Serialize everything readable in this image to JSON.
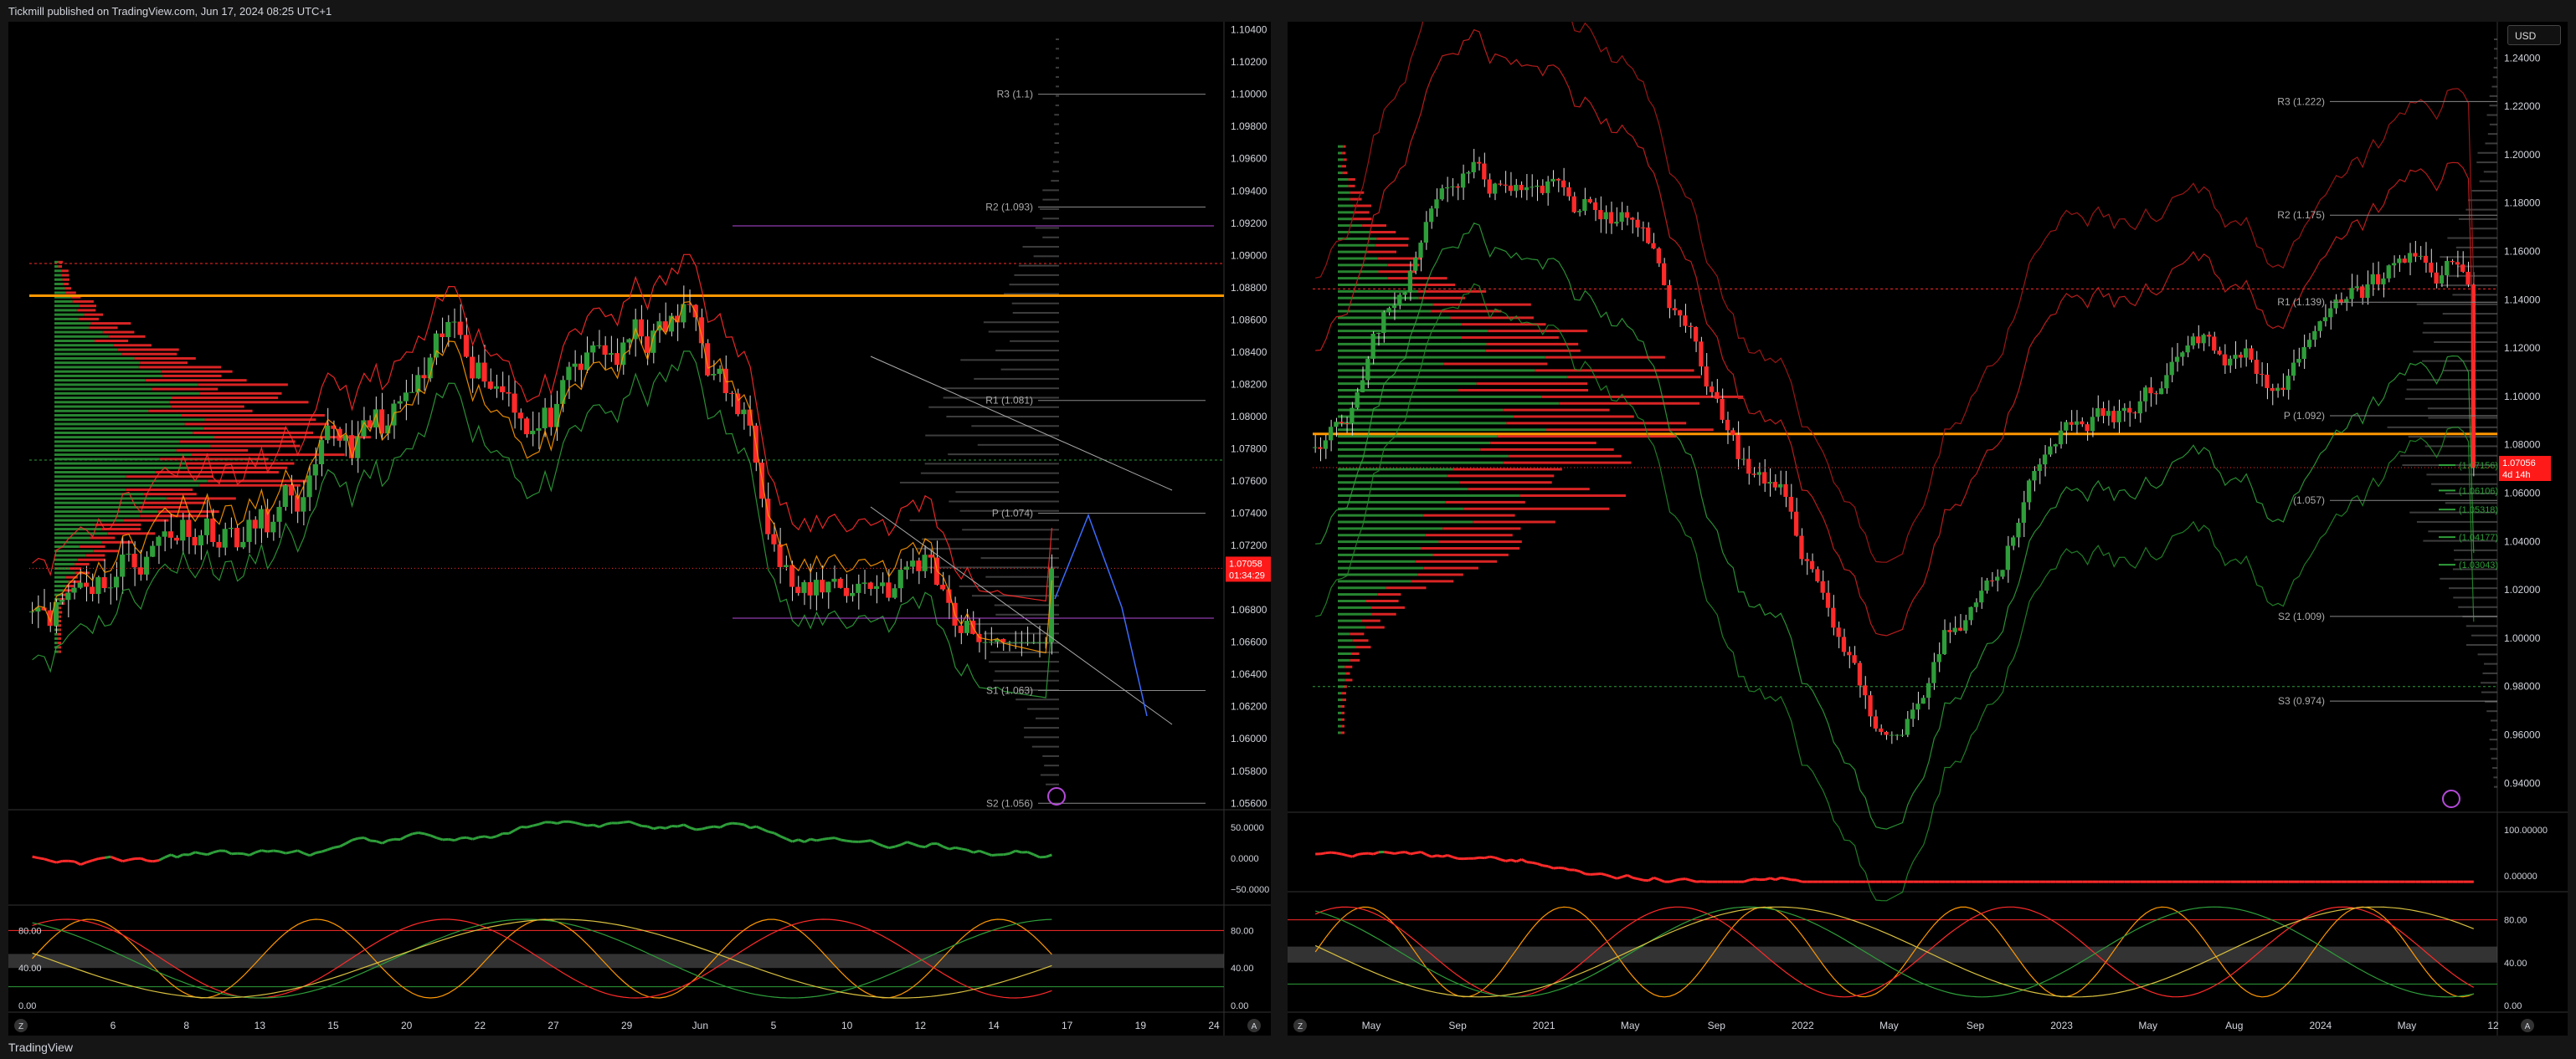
{
  "header": {
    "title": "Tickmill published on TradingView.com, Jun 17, 2024 08:25 UTC+1"
  },
  "footer": {
    "logo": "TradingView"
  },
  "colors": {
    "bull": "#2e9e3a",
    "bear": "#ff2a2a",
    "orange": "#ff9800",
    "purple": "#b44ad8",
    "grid": "#222222"
  },
  "left": {
    "price_ticks": [
      "1.10400",
      "1.10200",
      "1.10000",
      "1.09800",
      "1.09600",
      "1.09400",
      "1.09200",
      "1.09000",
      "1.08800",
      "1.08600",
      "1.08400",
      "1.08200",
      "1.08000",
      "1.07800",
      "1.07600",
      "1.07400",
      "1.07200",
      "1.07000",
      "1.06800",
      "1.06600",
      "1.06400",
      "1.06200",
      "1.06000",
      "1.05800",
      "1.05600"
    ],
    "price_range": [
      1.0556,
      1.1045
    ],
    "pivots": [
      {
        "label": "R3 (1.1)",
        "price": 1.1
      },
      {
        "label": "R2 (1.093)",
        "price": 1.093
      },
      {
        "label": "R1 (1.081)",
        "price": 1.081
      },
      {
        "label": "P (1.074)",
        "price": 1.074
      },
      {
        "label": "S1 (1.063)",
        "price": 1.063
      },
      {
        "label": "S2 (1.056)",
        "price": 1.056
      }
    ],
    "last_price": "1.07058",
    "countdown": "01:34:29",
    "osc1_ticks": [
      "50.0000",
      "0.0000",
      "−50.0000"
    ],
    "osc2_ticks_left": [
      "80.00",
      "40.00",
      "0.00"
    ],
    "osc2_ticks_right": [
      "80.00",
      "40.00",
      "0.00"
    ],
    "time_labels": [
      "6",
      "8",
      "13",
      "15",
      "20",
      "22",
      "27",
      "29",
      "Jun",
      "5",
      "10",
      "12",
      "14",
      "17",
      "19",
      "24"
    ],
    "z_button": "Z",
    "a_button": "A"
  },
  "right": {
    "currency": "USD",
    "price_ticks": [
      "1.24000",
      "1.22000",
      "1.20000",
      "1.18000",
      "1.16000",
      "1.14000",
      "1.12000",
      "1.10000",
      "1.08000",
      "1.06000",
      "1.04000",
      "1.02000",
      "1.00000",
      "0.98000",
      "0.96000",
      "0.94000"
    ],
    "price_range": [
      0.928,
      1.255
    ],
    "pivots": [
      {
        "label": "R3 (1.222)",
        "price": 1.222
      },
      {
        "label": "R2 (1.175)",
        "price": 1.175
      },
      {
        "label": "R1 (1.139)",
        "price": 1.139
      },
      {
        "label": "P (1.092)",
        "price": 1.092
      },
      {
        "label": "(1.057)",
        "price": 1.057
      },
      {
        "label": "S2 (1.009)",
        "price": 1.009
      },
      {
        "label": "S3 (0.974)",
        "price": 0.974
      }
    ],
    "band_labels": [
      {
        "label": "(1.07156)",
        "price": 1.0716
      },
      {
        "label": "(1.06106)",
        "price": 1.0611
      },
      {
        "label": "(1.05318)",
        "price": 1.0532
      },
      {
        "label": "(1.04177)",
        "price": 1.0418
      },
      {
        "label": "(1.03043)",
        "price": 1.0304
      }
    ],
    "last_price": "1.07056",
    "countdown": "4d 14h",
    "osc1_ticks": [
      "100.00000",
      "0.00000"
    ],
    "osc2_ticks": [
      "80.00",
      "40.00",
      "0.00"
    ],
    "time_labels": [
      "May",
      "Sep",
      "2021",
      "May",
      "Sep",
      "2022",
      "May",
      "Sep",
      "2023",
      "May",
      "Aug",
      "2024",
      "May",
      "12"
    ],
    "z_button": "Z",
    "a_button": "A"
  }
}
